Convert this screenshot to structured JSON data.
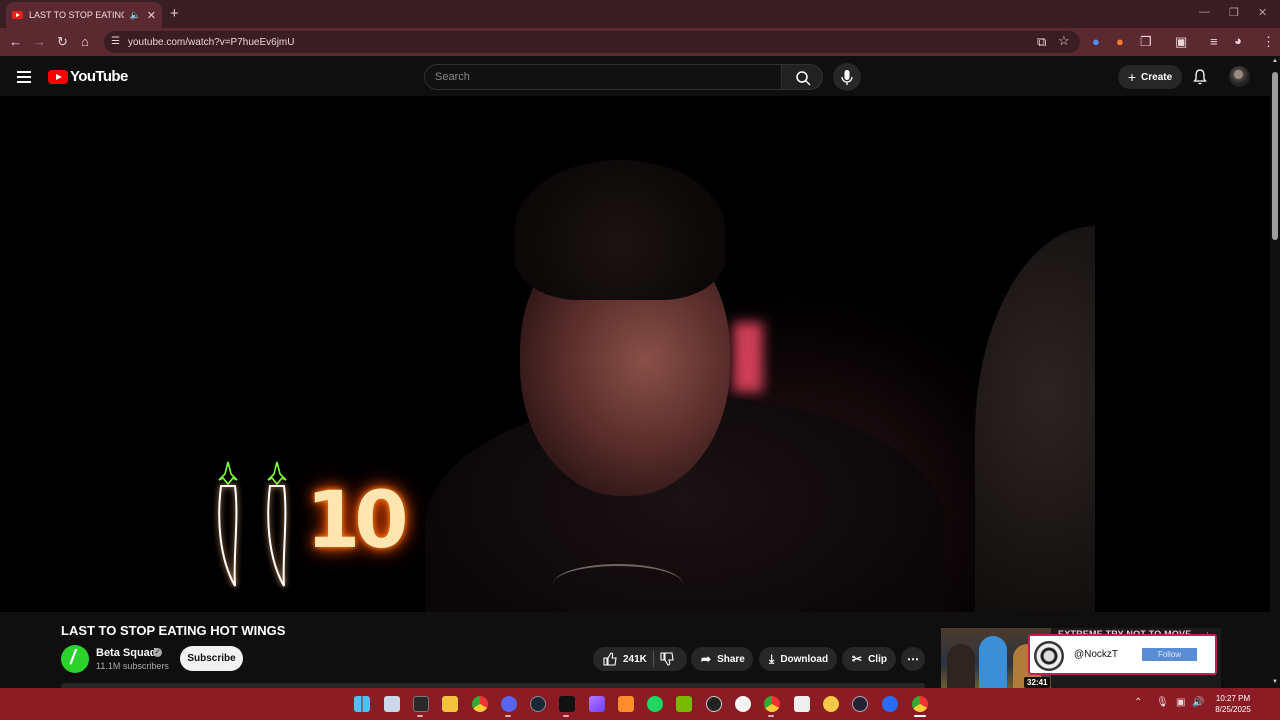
{
  "browser": {
    "tab_title": "LAST TO STOP EATING HOT WINGS",
    "tab_audio_icon": "speaker-icon",
    "url": "youtube.com/watch?v=P7hueEv6jmU"
  },
  "header": {
    "logo_text": "YouTube",
    "search_placeholder": "Search",
    "create_label": "Create"
  },
  "video": {
    "overlay_text": "10",
    "title": "LAST TO STOP EATING HOT WINGS"
  },
  "channel": {
    "name": "Beta Squad",
    "subscribers": "11.1M subscribers",
    "subscribe_label": "Subscribe"
  },
  "actions": {
    "likes": "241K",
    "share_label": "Share",
    "download_label": "Download",
    "clip_label": "Clip"
  },
  "sidebar_card": {
    "title": "EXTREME TRY NOT TO MOVE",
    "duration": "32:41",
    "popup_handle": "@NockzT",
    "popup_follow": "Follow"
  },
  "taskbar": {
    "time": "10:27 PM",
    "date": "8/25/2025"
  },
  "colors": {
    "browser_frame": "#3a1d22",
    "toolbar": "#5a2a30",
    "youtube_bg": "#0f0f0f",
    "taskbar": "#8c1c24",
    "youtube_red": "#ff0000"
  }
}
